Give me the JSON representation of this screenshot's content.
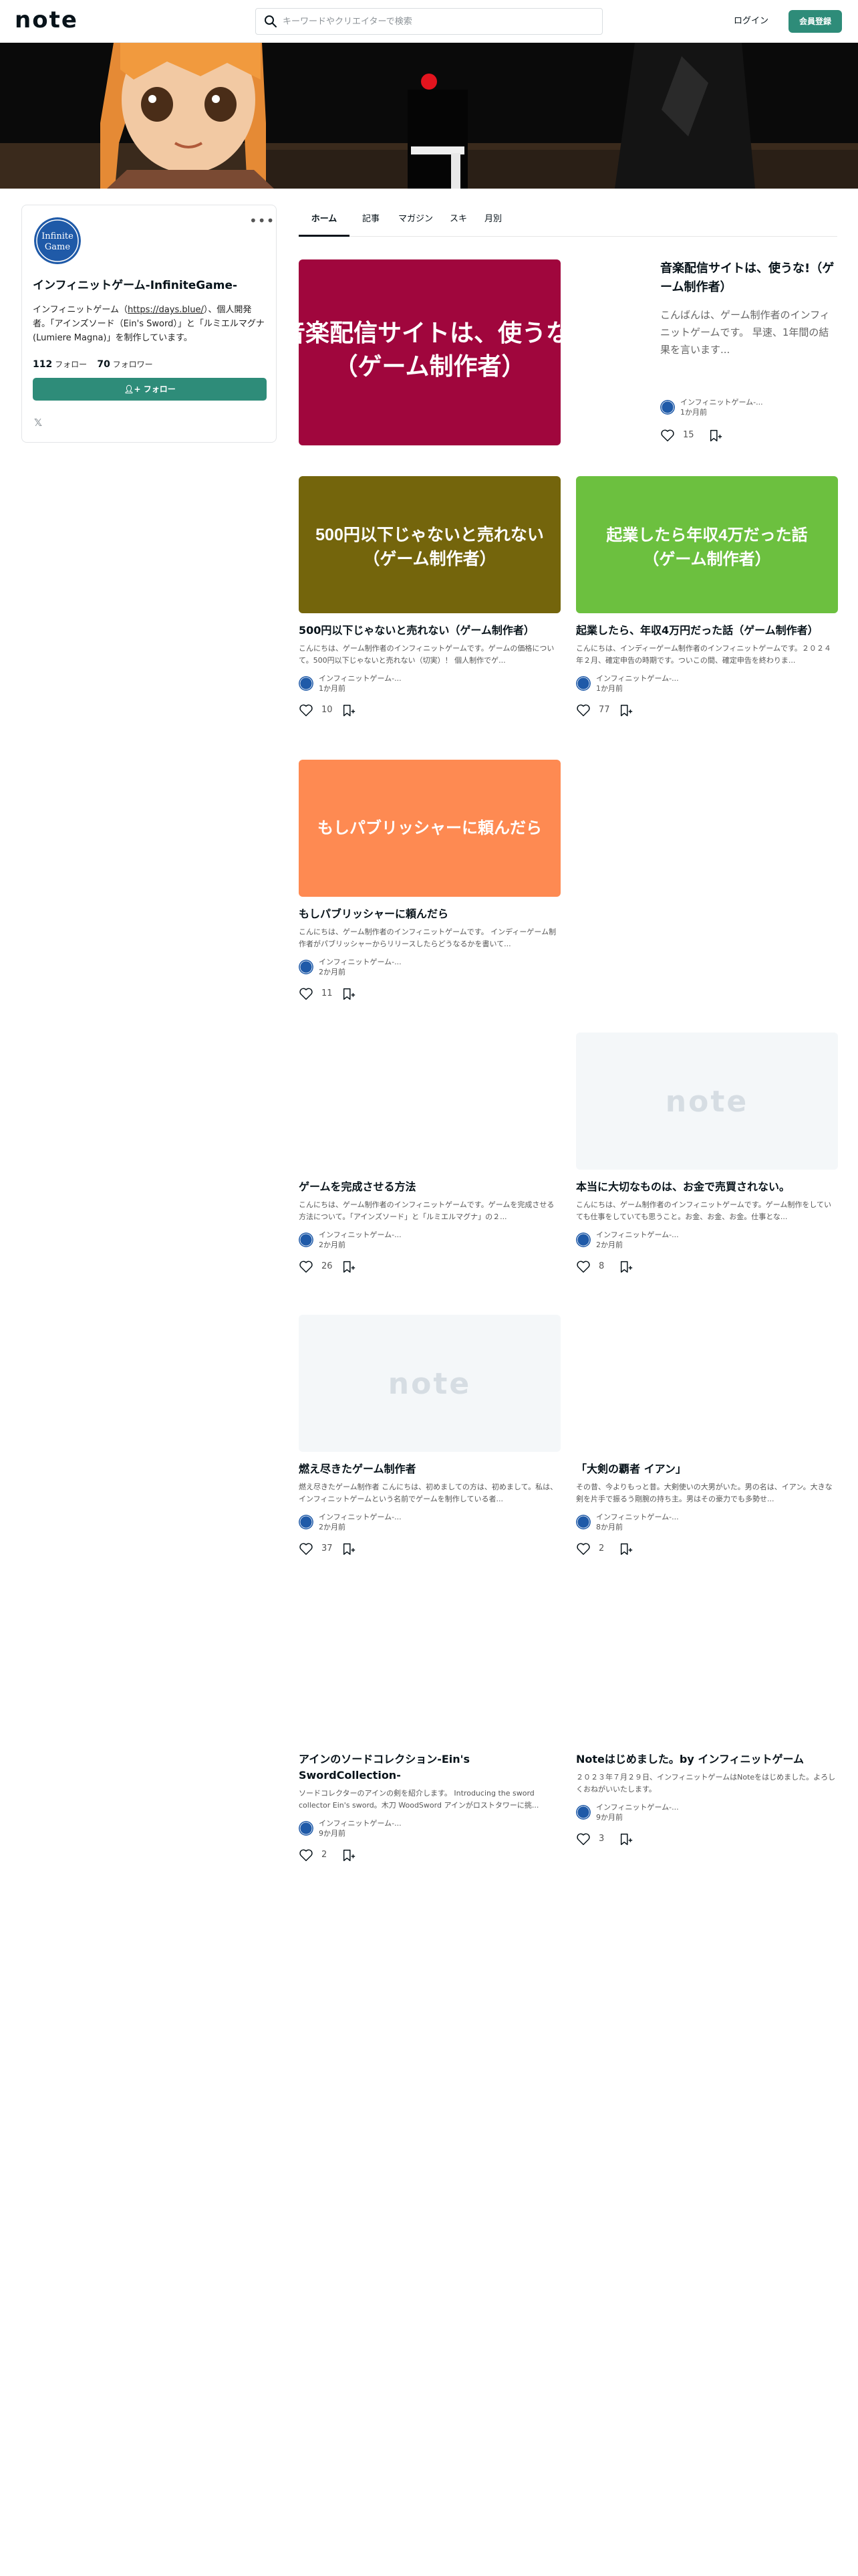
{
  "header": {
    "logo": "note",
    "search_placeholder": "キーワードやクリエイターで検索",
    "login_label": "ログイン",
    "signup_label": "会員登録"
  },
  "profile": {
    "avatar_text_1": "Infinite",
    "avatar_text_2": "Game",
    "name": "インフィニットゲーム-InfiniteGame-",
    "bio_before": "インフィニットゲーム（",
    "bio_link": "https://days.blue/",
    "bio_after": "）、個人開発者。「アインズソード（Ein's Sword）」と「ルミエルマグナ(Lumiere Magna)」を制作しています。",
    "following_count": "112",
    "following_label": "フォロー",
    "followers_count": "70",
    "followers_label": "フォロワー",
    "follow_button": "フォロー"
  },
  "tabs": [
    {
      "label": "ホーム"
    },
    {
      "label": "記事"
    },
    {
      "label": "マガジン"
    },
    {
      "label": "スキ"
    },
    {
      "label": "月別"
    }
  ],
  "featured": {
    "thumb_line1": "音楽配信サイトは、使うな!",
    "thumb_line2": "（ゲーム制作者）",
    "title": "音楽配信サイトは、使うな!（ゲーム制作者）",
    "excerpt": "こんばんは、ゲーム制作者のインフィニットゲームです。 早速、1年間の結果を言います...",
    "author": "インフィニットゲーム-...",
    "time": "1か月前",
    "likes": "15",
    "thumb_color": "#a0063d"
  },
  "articles": [
    {
      "thumb_line1": "500円以下じゃないと売れない",
      "thumb_line2": "（ゲーム制作者）",
      "thumb_color": "#74650c",
      "title": "500円以下じゃないと売れない（ゲーム制作者）",
      "excerpt": "こんにちは、ゲーム制作者のインフィニットゲームです。ゲームの価格について。500円以下じゃないと売れない（切実）！ 個人制作でゲ...",
      "author": "インフィニットゲーム-...",
      "time": "1か月前",
      "likes": "10"
    },
    {
      "thumb_line1": "起業したら年収4万だった話",
      "thumb_line2": "（ゲーム制作者）",
      "thumb_color": "#6cc03f",
      "title": "起業したら、年収4万円だった話（ゲーム制作者）",
      "excerpt": "こんにちは、インディーゲーム制作者のインフィニットゲームです。２０２４年２月、確定申告の時期です。ついこの間、確定申告を終わりま...",
      "author": "インフィニットゲーム-...",
      "time": "1か月前",
      "likes": "77"
    },
    {
      "thumb_line1": "もしパブリッシャーに頼んだら",
      "thumb_line2": "",
      "thumb_color": "#fe8a52",
      "title": "もしパブリッシャーに頼んだら",
      "excerpt": "こんにちは、ゲーム制作者のインフィニットゲームです。 インディーゲーム制作者がパブリッシャーからリリースしたらどうなるかを書いて...",
      "author": "インフィニットゲーム-...",
      "time": "2か月前",
      "likes": "11"
    },
    {
      "thumb_line1": "",
      "thumb_line2": "",
      "thumb_color": "#ffffff",
      "title": "ゲームを完成させる方法",
      "excerpt": "こんにちは、ゲーム制作者のインフィニットゲームです。ゲームを完成させる方法について。「アインズソード」と「ルミエルマグナ」の２...",
      "author": "インフィニットゲーム-...",
      "time": "2か月前",
      "likes": "26"
    },
    {
      "thumb_line1": "note",
      "thumb_line2": "",
      "thumb_color": "#f4f7f9",
      "title": "本当に大切なものは、お金で売買されない。",
      "excerpt": "こんにちは、ゲーム制作者のインフィニットゲームです。ゲーム制作をしていても仕事をしていても思うこと。お金、お金、お金。仕事とな...",
      "author": "インフィニットゲーム-...",
      "time": "2か月前",
      "likes": "8"
    },
    {
      "thumb_line1": "note",
      "thumb_line2": "",
      "thumb_color": "#f4f7f9",
      "title": "燃え尽きたゲーム制作者",
      "excerpt": "燃え尽きたゲーム制作者 こんにちは、初めましての方は、初めまして。私は、インフィニットゲームという名前でゲームを制作している者...",
      "author": "インフィニットゲーム-...",
      "time": "2か月前",
      "likes": "37"
    },
    {
      "thumb_line1": "",
      "thumb_line2": "",
      "thumb_color": "#ffffff",
      "title": "「大剣の覇者 イアン」",
      "excerpt": "その昔、今よりもっと昔。大剣使いの大男がいた。男の名は、イアン。大きな剣を片手で振るう剛腕の持ち主。男はその豪力でも多勢せ...",
      "author": "インフィニットゲーム-...",
      "time": "8か月前",
      "likes": "2"
    },
    {
      "thumb_line1": "",
      "thumb_line2": "",
      "thumb_color": "#ffffff",
      "title": "アインのソードコレクション-Ein's SwordCollection-",
      "excerpt": "ソードコレクターのアインの剣を紹介します。 Introducing the sword collector Ein's sword。木刀 WoodSword アインがロストタワーに挑...",
      "author": "インフィニットゲーム-...",
      "time": "9か月前",
      "likes": "2"
    },
    {
      "thumb_line1": "",
      "thumb_line2": "",
      "thumb_color": "#ffffff",
      "title": "Noteはじめました。by インフィニットゲーム",
      "excerpt": "２０２３年７月２９日、インフィニットゲームはNoteをはじめました。よろしくおねがいいたします。",
      "author": "インフィニットゲーム-...",
      "time": "9か月前",
      "likes": "3"
    }
  ],
  "colors": {
    "accent": "#2e8c79",
    "text": "#08131a",
    "muted": "#555555"
  }
}
